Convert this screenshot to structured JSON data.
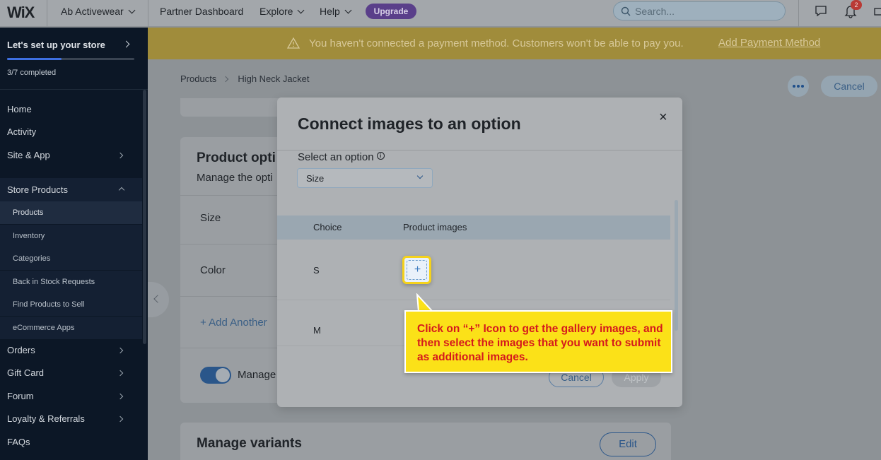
{
  "topbar": {
    "logo": "WiX",
    "site_name": "Ab Activewear",
    "partner_dashboard": "Partner Dashboard",
    "explore": "Explore",
    "help": "Help",
    "upgrade": "Upgrade",
    "search_placeholder": "Search...",
    "notification_count": "2"
  },
  "sidebar": {
    "setup_title": "Let's set up your store",
    "setup_progress": "3/7 completed",
    "setup_progress_fraction": 0.43,
    "items": [
      {
        "label": "Home"
      },
      {
        "label": "Activity"
      },
      {
        "label": "Site & App"
      },
      {
        "label": "Store Products"
      },
      {
        "label": "Orders"
      },
      {
        "label": "Gift Card"
      },
      {
        "label": "Forum"
      },
      {
        "label": "Loyalty & Referrals"
      },
      {
        "label": "FAQs"
      }
    ],
    "sub_items": [
      {
        "label": "Products"
      },
      {
        "label": "Inventory"
      },
      {
        "label": "Categories"
      },
      {
        "label": "Back in Stock Requests"
      },
      {
        "label": "Find Products to Sell"
      },
      {
        "label": "eCommerce Apps"
      }
    ]
  },
  "banner": {
    "text": "You haven't connected a payment method. Customers won't be able to pay you.",
    "link": "Add Payment Method"
  },
  "breadcrumb": {
    "parent": "Products",
    "current": "High Neck Jacket"
  },
  "header_actions": {
    "cancel": "Cancel"
  },
  "product_options": {
    "title": "Product opti",
    "subtitle": "Manage the opti",
    "options": [
      "Size",
      "Color"
    ],
    "add_another": "+ Add Another",
    "manage_label": "Manage"
  },
  "manage_variants": {
    "title": "Manage variants",
    "edit": "Edit"
  },
  "modal": {
    "title": "Connect images to an option",
    "close": "×",
    "select_label": "Select an option",
    "info": "i",
    "selected_option": "Size",
    "col_choice": "Choice",
    "col_images": "Product images",
    "rows": [
      {
        "choice": "S"
      },
      {
        "choice": "M"
      }
    ],
    "cancel": "Cancel",
    "apply": "Apply",
    "plus": "+"
  },
  "callout": {
    "text": "Click on “+” Icon to get the gallery images, and then select the images that you want to submit as additional images."
  }
}
